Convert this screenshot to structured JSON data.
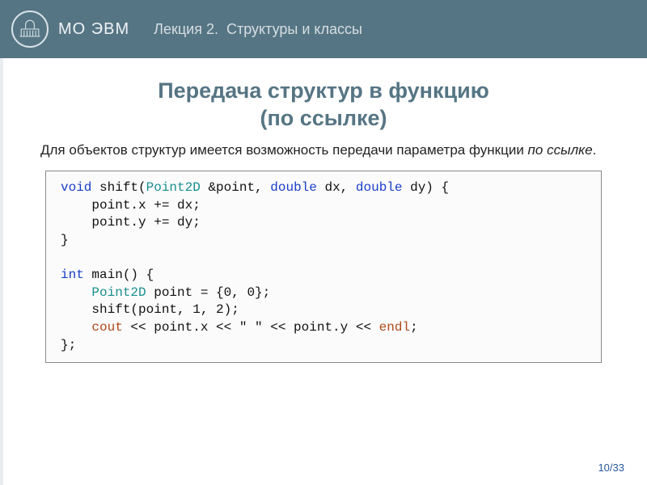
{
  "header": {
    "brand": "МО ЭВМ",
    "lecture_prefix": "Лекция 2.",
    "lecture_title": "Структуры и классы"
  },
  "slide": {
    "title_line1": "Передача структур в функцию",
    "title_line2": "(по ссылке)",
    "desc_1": "Для объектов структур имеется возможность передачи параметра функции ",
    "desc_em": "по ссылке",
    "desc_2": "."
  },
  "code": {
    "kw_void": "void",
    "fn_shift": " shift(",
    "type_point2d_a": "Point2D",
    "amp_point": " &point, ",
    "kw_double1": "double",
    "dx": " dx, ",
    "kw_double2": "double",
    "dy": " dy) {",
    "body1": "    point.x += dx;",
    "body2": "    point.y += dy;",
    "close1": "}",
    "blank": "",
    "kw_int": "int",
    "main_sig": " main() {",
    "indent": "    ",
    "type_point2d_b": "Point2D",
    "decl": " point = {0, 0};",
    "shift_call": "    shift(point, 1, 2);",
    "cout_kw": "cout",
    "cout_rest1": " << point.x << \" \" << point.y << ",
    "endl_kw": "endl",
    "cout_rest2": ";",
    "close2": "};"
  },
  "page": {
    "current": "10",
    "sep": "/",
    "total": "33"
  }
}
